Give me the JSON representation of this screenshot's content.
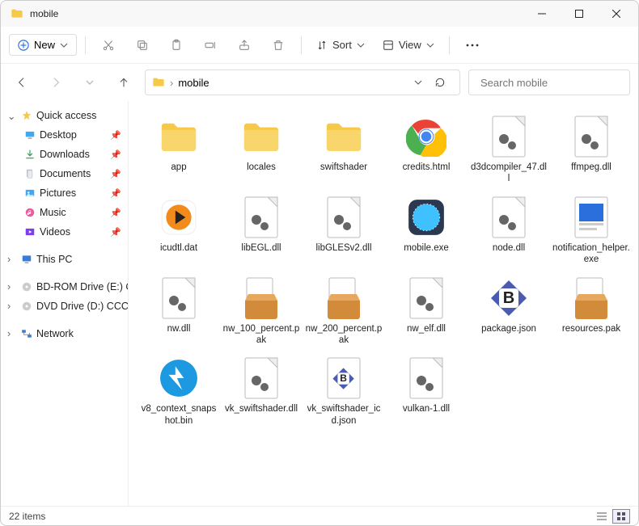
{
  "window": {
    "title": "mobile"
  },
  "toolbar": {
    "new_label": "New",
    "sort_label": "Sort",
    "view_label": "View"
  },
  "address": {
    "path": "mobile",
    "separator": "›",
    "refresh_name": "refresh"
  },
  "search": {
    "placeholder": "Search mobile"
  },
  "sidebar": {
    "quick_access": "Quick access",
    "items": [
      {
        "label": "Desktop",
        "icon": "desktop"
      },
      {
        "label": "Downloads",
        "icon": "downloads"
      },
      {
        "label": "Documents",
        "icon": "documents"
      },
      {
        "label": "Pictures",
        "icon": "pictures"
      },
      {
        "label": "Music",
        "icon": "music"
      },
      {
        "label": "Videos",
        "icon": "videos"
      }
    ],
    "this_pc": "This PC",
    "bdrom": "BD-ROM Drive (E:) C",
    "dvd": "DVD Drive (D:) CCCC",
    "network": "Network"
  },
  "files": [
    {
      "name": "app",
      "type": "folder"
    },
    {
      "name": "locales",
      "type": "folder"
    },
    {
      "name": "swiftshader",
      "type": "folder"
    },
    {
      "name": "credits.html",
      "type": "chrome"
    },
    {
      "name": "d3dcompiler_47.dll",
      "type": "dll"
    },
    {
      "name": "ffmpeg.dll",
      "type": "dll"
    },
    {
      "name": "icudtl.dat",
      "type": "vlc"
    },
    {
      "name": "libEGL.dll",
      "type": "dll"
    },
    {
      "name": "libGLESv2.dll",
      "type": "dll"
    },
    {
      "name": "mobile.exe",
      "type": "safari"
    },
    {
      "name": "node.dll",
      "type": "dll"
    },
    {
      "name": "notification_helper.exe",
      "type": "notif"
    },
    {
      "name": "nw.dll",
      "type": "dll"
    },
    {
      "name": "nw_100_percent.pak",
      "type": "pak"
    },
    {
      "name": "nw_200_percent.pak",
      "type": "pak"
    },
    {
      "name": "nw_elf.dll",
      "type": "dll"
    },
    {
      "name": "package.json",
      "type": "bbedit"
    },
    {
      "name": "resources.pak",
      "type": "pak"
    },
    {
      "name": "v8_context_snapshot.bin",
      "type": "daemon"
    },
    {
      "name": "vk_swiftshader.dll",
      "type": "dll"
    },
    {
      "name": "vk_swiftshader_icd.json",
      "type": "bbedit2"
    },
    {
      "name": "vulkan-1.dll",
      "type": "dll"
    }
  ],
  "status": {
    "count_label": "22 items"
  }
}
